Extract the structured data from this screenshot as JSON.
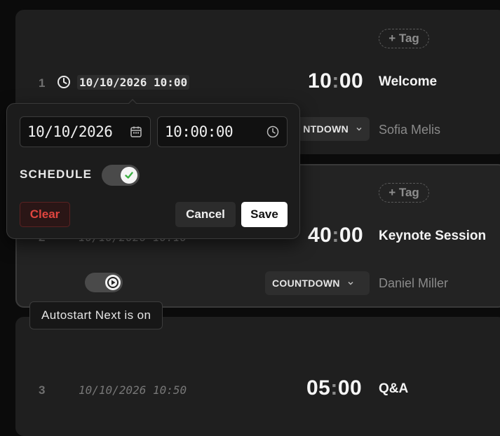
{
  "events": [
    {
      "index": "1",
      "scheduled_time": "10/10/2026 10:00",
      "duration_min": "10",
      "duration_sec": "00",
      "title": "Welcome",
      "tag_label": "+ Tag",
      "timer_type": "COUNTDOWN",
      "timer_type_visible": "NTDOWN",
      "presenter": "Sofia Melis"
    },
    {
      "index": "2",
      "scheduled_time": "10/10/2026 10:10",
      "duration_min": "40",
      "duration_sec": "00",
      "title": "Keynote Session",
      "tag_label": "+ Tag",
      "timer_type": "COUNTDOWN",
      "presenter": "Daniel Miller"
    },
    {
      "index": "3",
      "scheduled_time": "10/10/2026 10:50",
      "duration_min": "05",
      "duration_sec": "00",
      "title": "Q&A"
    }
  ],
  "tooltip": {
    "text": "Autostart Next is on"
  },
  "popover": {
    "date_value": "10/10/2026",
    "time_value": "10:00:00",
    "schedule_label": "SCHEDULE",
    "schedule_enabled": true,
    "clear_label": "Clear",
    "cancel_label": "Cancel",
    "save_label": "Save"
  },
  "colors": {
    "accent_check": "#3cb043",
    "danger": "#e0453f",
    "background": "#0b0b0b",
    "card": "#1f1f1f"
  },
  "icons": {
    "clock": "clock-icon",
    "calendar": "calendar-icon",
    "chevron": "chevron-down-icon",
    "play": "play-icon",
    "check": "check-icon"
  }
}
